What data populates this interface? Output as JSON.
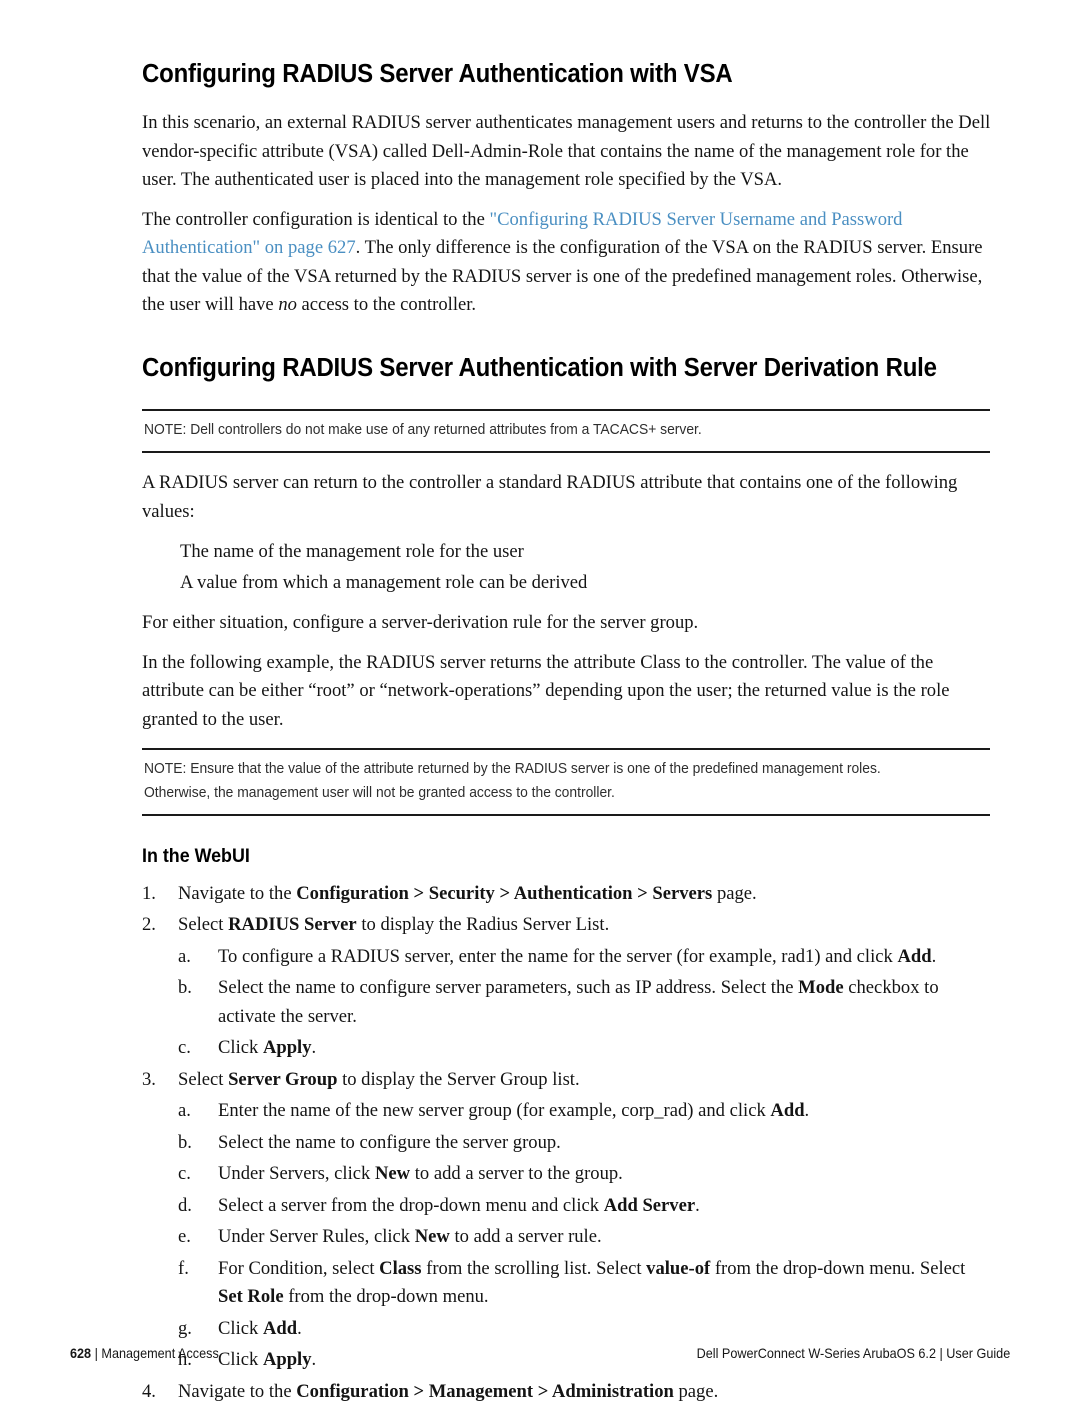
{
  "page": {
    "heading_1": "Configuring RADIUS Server Authentication with VSA",
    "heading_2": "Configuring RADIUS Server Authentication with Server Derivation Rule",
    "heading_webui": "In the WebUI"
  },
  "paragraphs": {
    "intro": "In this scenario, an external RADIUS server authenticates management users and returns to the controller the Dell vendor-specific attribute (VSA) called Dell-Admin-Role that contains the name of the management role for the user. The authenticated user is placed into the management role specified by the VSA.",
    "xref_lead": "The controller configuration is identical to the ",
    "xref_link": "\"Configuring RADIUS Server Username and Password Authentication\" on page 627",
    "xref_tail_a": ". The only difference is the configuration of the VSA on the RADIUS server. Ensure that the value of the VSA returned by the RADIUS server is one of the predefined management roles. Otherwise, the user will have ",
    "xref_tail_italic": "no",
    "xref_tail_b": " access to the controller.",
    "radius_values": "A RADIUS server can return to the controller a standard RADIUS attribute that contains one of the following values:",
    "either_situation": "For either situation, configure a server-derivation rule for the server group.",
    "example_intro": "In the following example, the RADIUS server returns the attribute Class to the controller. The value of the attribute can be either “root” or “network-operations” depending upon the user; the returned value is the role granted to the user."
  },
  "bullets": [
    "The name of the management role for the user",
    "A value from which a management role can be derived"
  ],
  "notes": [
    {
      "id": "note-tacacs",
      "text": "NOTE:  Dell controllers do not make use of any returned attributes from a TACACS+ server."
    },
    {
      "id": "note-predefined-roles",
      "text": "NOTE: Ensure that the value of the attribute returned by the RADIUS server is one of the predefined management roles. Otherwise, the management user will not be granted access to the controller."
    }
  ],
  "steps": [
    {
      "marker": "1.",
      "segments": [
        {
          "text": "Navigate to the ",
          "bold": false
        },
        {
          "text": "Configuration > Security > Authentication > Servers",
          "bold": true
        },
        {
          "text": " page.",
          "bold": false
        }
      ]
    },
    {
      "marker": "2.",
      "segments": [
        {
          "text": "Select ",
          "bold": false
        },
        {
          "text": "RADIUS Server",
          "bold": true
        },
        {
          "text": " to display the Radius Server List.",
          "bold": false
        }
      ],
      "substeps": [
        {
          "marker": "a.",
          "segments": [
            {
              "text": "To configure a RADIUS server, enter the name for the server (for example, rad1) and click ",
              "bold": false
            },
            {
              "text": "Add",
              "bold": true
            },
            {
              "text": ".",
              "bold": false
            }
          ]
        },
        {
          "marker": "b.",
          "segments": [
            {
              "text": "Select the name to configure server parameters, such as IP address. Select the ",
              "bold": false
            },
            {
              "text": "Mode",
              "bold": true
            },
            {
              "text": " checkbox to activate the server.",
              "bold": false
            }
          ]
        },
        {
          "marker": "c.",
          "segments": [
            {
              "text": "Click ",
              "bold": false
            },
            {
              "text": "Apply",
              "bold": true
            },
            {
              "text": ".",
              "bold": false
            }
          ]
        }
      ]
    },
    {
      "marker": "3.",
      "segments": [
        {
          "text": "Select ",
          "bold": false
        },
        {
          "text": "Server Group",
          "bold": true
        },
        {
          "text": " to display the Server Group list.",
          "bold": false
        }
      ],
      "substeps": [
        {
          "marker": "a.",
          "segments": [
            {
              "text": "Enter the name of the new server group (for example, corp_rad) and click ",
              "bold": false
            },
            {
              "text": "Add",
              "bold": true
            },
            {
              "text": ".",
              "bold": false
            }
          ]
        },
        {
          "marker": "b.",
          "segments": [
            {
              "text": "Select the name to configure the server group.",
              "bold": false
            }
          ]
        },
        {
          "marker": "c.",
          "segments": [
            {
              "text": "Under Servers, click ",
              "bold": false
            },
            {
              "text": "New",
              "bold": true
            },
            {
              "text": " to add a server to the group.",
              "bold": false
            }
          ]
        },
        {
          "marker": "d.",
          "segments": [
            {
              "text": "Select a server from the drop-down menu and click ",
              "bold": false
            },
            {
              "text": "Add Server",
              "bold": true
            },
            {
              "text": ".",
              "bold": false
            }
          ]
        },
        {
          "marker": "e.",
          "segments": [
            {
              "text": "Under Server Rules, click ",
              "bold": false
            },
            {
              "text": "New",
              "bold": true
            },
            {
              "text": " to add a server rule.",
              "bold": false
            }
          ]
        },
        {
          "marker": "f.",
          "segments": [
            {
              "text": "For Condition, select ",
              "bold": false
            },
            {
              "text": "Class",
              "bold": true
            },
            {
              "text": " from the scrolling list. Select ",
              "bold": false
            },
            {
              "text": "value-of",
              "bold": true
            },
            {
              "text": " from the drop-down menu. Select ",
              "bold": false
            },
            {
              "text": "Set Role",
              "bold": true
            },
            {
              "text": " from the drop-down menu.",
              "bold": false
            }
          ]
        },
        {
          "marker": "g.",
          "segments": [
            {
              "text": "Click ",
              "bold": false
            },
            {
              "text": "Add",
              "bold": true
            },
            {
              "text": ".",
              "bold": false
            }
          ]
        },
        {
          "marker": "h.",
          "segments": [
            {
              "text": "Click ",
              "bold": false
            },
            {
              "text": "Apply",
              "bold": true
            },
            {
              "text": ".",
              "bold": false
            }
          ]
        }
      ]
    },
    {
      "marker": "4.",
      "segments": [
        {
          "text": "Navigate to the ",
          "bold": false
        },
        {
          "text": "Configuration > Management > Administration",
          "bold": true
        },
        {
          "text": " page.",
          "bold": false
        }
      ]
    }
  ],
  "footer": {
    "page_number": "628",
    "separator": "|",
    "section": "Management Access",
    "document": "Dell PowerConnect W-Series ArubaOS 6.2 | User Guide"
  },
  "colors": {
    "link": "#4a8fc2",
    "text": "#141414",
    "rule": "#1a1a1a"
  }
}
